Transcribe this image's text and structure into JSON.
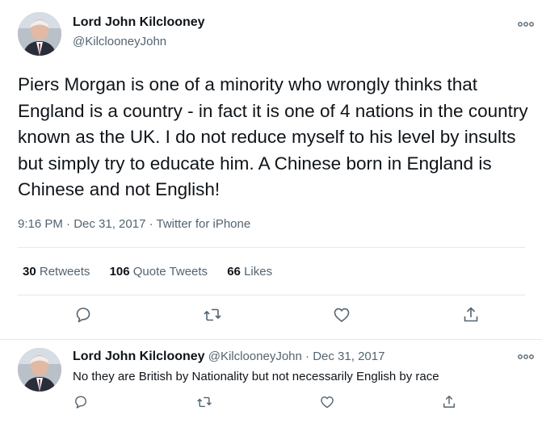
{
  "main_tweet": {
    "author_name": "Lord John Kilclooney",
    "author_handle": "@KilclooneyJohn",
    "text": "Piers Morgan is one of a minority who wrongly thinks that England is a country - in fact it is one of 4 nations in the country known as the UK. I do not reduce myself to his level by insults but simply try to educate him. A Chinese born in England is Chinese and not English!",
    "meta": "9:16 PM · Dec 31, 2017 · Twitter for iPhone",
    "stats": [
      {
        "count": "30",
        "label": "Retweets"
      },
      {
        "count": "106",
        "label": "Quote Tweets"
      },
      {
        "count": "66",
        "label": "Likes"
      }
    ],
    "actions": [
      "reply-icon",
      "retweet-icon",
      "like-icon",
      "share-icon"
    ]
  },
  "reply_tweet": {
    "author_name": "Lord John Kilclooney",
    "author_handle": "@KilclooneyJohn",
    "separator": "·",
    "date": "Dec 31, 2017",
    "text": "No they are British by Nationality but not necessarily English by race",
    "actions": [
      "reply-icon",
      "retweet-icon",
      "like-icon",
      "share-icon"
    ]
  },
  "colors": {
    "text_primary": "#0f1419",
    "text_secondary": "#536471",
    "divider": "#e6e9ea"
  }
}
